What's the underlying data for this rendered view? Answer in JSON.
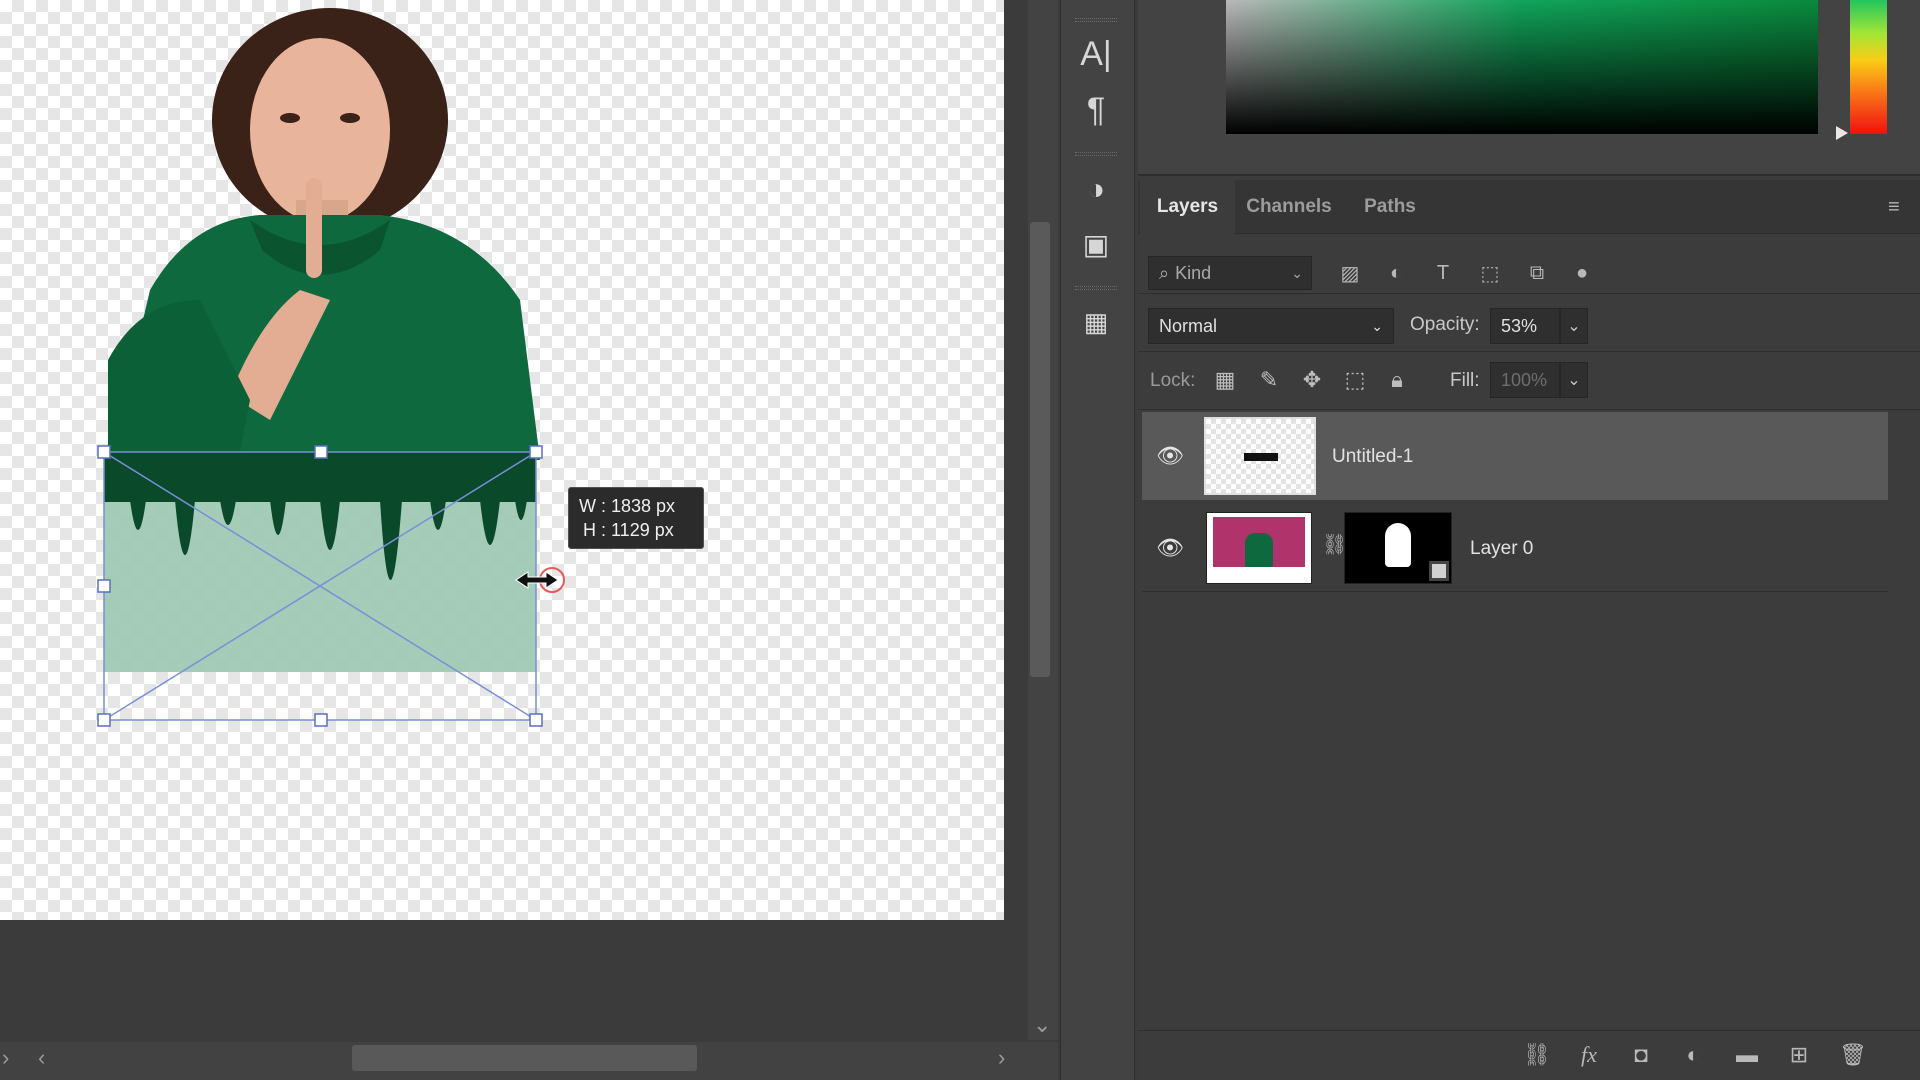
{
  "canvas": {
    "transform_tooltip": {
      "width_text": "W : 1838 px",
      "height_text": "H : 1129 px"
    }
  },
  "tools": {
    "items": [
      "character-tool-icon",
      "paragraph-tool-icon",
      "adjustments-icon",
      "artboard-icon",
      "image-icon"
    ]
  },
  "color_panel": {
    "accent": "#11a45a"
  },
  "layers_panel": {
    "tabs": [
      {
        "label": "Layers",
        "active": true
      },
      {
        "label": "Channels",
        "active": false
      },
      {
        "label": "Paths",
        "active": false
      }
    ],
    "filter": {
      "placeholder": "Kind"
    },
    "blend_mode": "Normal",
    "opacity_label": "Opacity:",
    "opacity_value": "53%",
    "lock_label": "Lock:",
    "fill_label": "Fill:",
    "fill_value": "100%",
    "layers": [
      {
        "name": "Untitled-1",
        "visible": true,
        "selected": true
      },
      {
        "name": "Layer 0",
        "visible": true,
        "selected": false,
        "has_mask": true
      }
    ]
  },
  "colors": {
    "selection": "#7a8fd6",
    "selected_row": "#595959"
  }
}
